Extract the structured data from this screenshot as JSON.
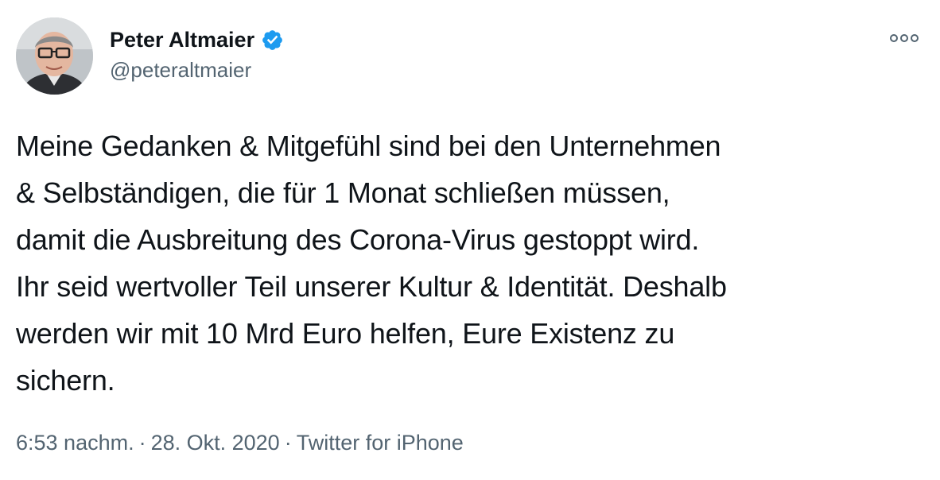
{
  "author": {
    "display_name": "Peter Altmaier",
    "handle": "@peteraltmaier",
    "verified": true,
    "verified_color": "#1d9bf0"
  },
  "tweet": {
    "lines": [
      "Meine Gedanken & Mitgefühl sind bei den Unternehmen",
      "& Selbständigen, die für 1 Monat schließen müssen,",
      "damit die Ausbreitung des Corona-Virus gestoppt wird.",
      "Ihr seid wertvoller Teil unserer Kultur & Identität. Deshalb",
      "werden wir mit 10 Mrd Euro helfen, Eure Existenz zu",
      "sichern."
    ]
  },
  "meta": {
    "time": "6:53 nachm.",
    "separator": "·",
    "date": "28. Okt. 2020",
    "source": "Twitter for iPhone"
  },
  "icons": {
    "more": "more-options-icon",
    "verified": "verified-badge-icon"
  },
  "colors": {
    "text": "#0f1419",
    "secondary": "#536471"
  }
}
